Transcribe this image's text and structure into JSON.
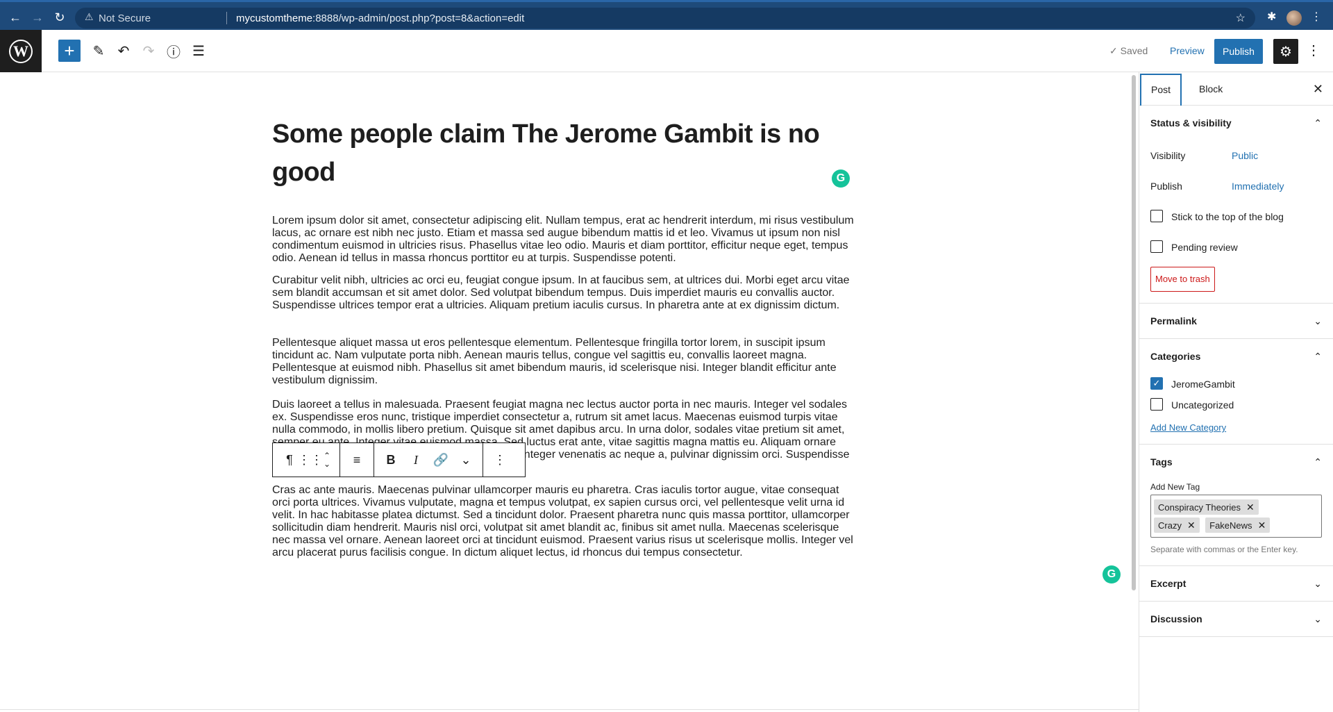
{
  "browser": {
    "not_secure": "Not Secure",
    "url_host": "mycustomtheme",
    "url_rest": ":8888/wp-admin/post.php?post=8&action=edit"
  },
  "toolbar": {
    "saved_label": "Saved",
    "preview_label": "Preview",
    "publish_label": "Publish"
  },
  "post": {
    "title": "Some people claim The Jerome Gambit is no good",
    "paragraphs": [
      "Lorem ipsum dolor sit amet, consectetur adipiscing elit. Nullam tempus, erat ac hendrerit interdum, mi risus vestibulum lacus, ac ornare est nibh nec justo. Etiam et massa sed augue bibendum mattis id et leo. Vivamus ut ipsum non nisl condimentum euismod in ultricies risus. Phasellus vitae leo odio. Mauris et diam porttitor, efficitur neque eget, tempus odio. Aenean id tellus in massa rhoncus porttitor eu at turpis. Suspendisse potenti.",
      "Curabitur velit nibh, ultricies ac orci eu, feugiat congue ipsum. In at faucibus sem, at ultrices dui. Morbi eget arcu vitae sem blandit accumsan et sit amet dolor. Sed volutpat bibendum tempus. Duis imperdiet mauris eu convallis auctor. Suspendisse ultrices tempor erat a ultricies. Aliquam pretium iaculis cursus. In pharetra ante at ex dignissim dictum.",
      "Pellentesque aliquet massa ut eros pellentesque elementum. Pellentesque fringilla tortor lorem, in suscipit ipsum tincidunt ac. Nam vulputate porta nibh. Aenean mauris tellus, congue vel sagittis eu, convallis laoreet magna. Pellentesque at euismod nibh. Phasellus sit amet bibendum mauris, id scelerisque nisi. Integer blandit efficitur ante vestibulum dignissim.",
      "Duis laoreet a tellus in malesuada. Praesent feugiat magna nec lectus auctor porta in nec mauris. Integer vel sodales ex. Suspendisse eros nunc, tristique imperdiet consectetur a, rutrum sit amet lacus. Maecenas euismod turpis vitae nulla commodo, in mollis libero pretium. Quisque sit amet dapibus arcu. In urna dolor, sodales vitae pretium sit amet, semper eu ante. Integer vitae euismod massa. Sed luctus erat ante, vitae sagittis magna mattis eu. Aliquam ornare tortor id risus pharetra, sed vestibulum mi facilisis. Integer venenatis ac neque a, pulvinar dignissim orci. Suspendisse sit amet mi nisi.",
      "Cras ac ante mauris. Maecenas pulvinar ullamcorper mauris eu pharetra. Cras iaculis tortor augue, vitae consequat orci porta ultrices. Vivamus vulputate, magna et tempus volutpat, ex sapien cursus orci, vel pellentesque velit urna id velit. In hac habitasse platea dictumst. Sed a tincidunt dolor. Praesent pharetra nunc quis massa porttitor, ullamcorper sollicitudin diam hendrerit. Mauris nisl orci, volutpat sit amet blandit ac, finibus sit amet nulla. Maecenas scelerisque nec massa vel ornare. Aenean laoreet orci at tincidunt euismod. Praesent varius risus ut scelerisque mollis. Integer vel arcu placerat purus facilisis congue. In dictum aliquet lectus, id rhoncus dui tempus consectetur."
    ]
  },
  "sidebar": {
    "tab_post": "Post",
    "tab_block": "Block",
    "status": {
      "heading": "Status & visibility",
      "visibility_label": "Visibility",
      "visibility_value": "Public",
      "publish_label": "Publish",
      "publish_value": "Immediately",
      "stick_label": "Stick to the top of the blog",
      "pending_label": "Pending review",
      "trash_label": "Move to trash"
    },
    "permalink_heading": "Permalink",
    "categories": {
      "heading": "Categories",
      "items": [
        {
          "label": "JeromeGambit",
          "checked": true
        },
        {
          "label": "Uncategorized",
          "checked": false
        }
      ],
      "add_new": "Add New Category"
    },
    "tags": {
      "heading": "Tags",
      "add_label": "Add New Tag",
      "items": [
        "Conspiracy Theories",
        "Crazy",
        "FakeNews"
      ],
      "help": "Separate with commas or the Enter key."
    },
    "excerpt_heading": "Excerpt",
    "discussion_heading": "Discussion"
  },
  "colors": {
    "accent": "#2271b1",
    "chrome": "#1e4a7a",
    "danger": "#cc1818",
    "grammarly": "#15c39a"
  }
}
